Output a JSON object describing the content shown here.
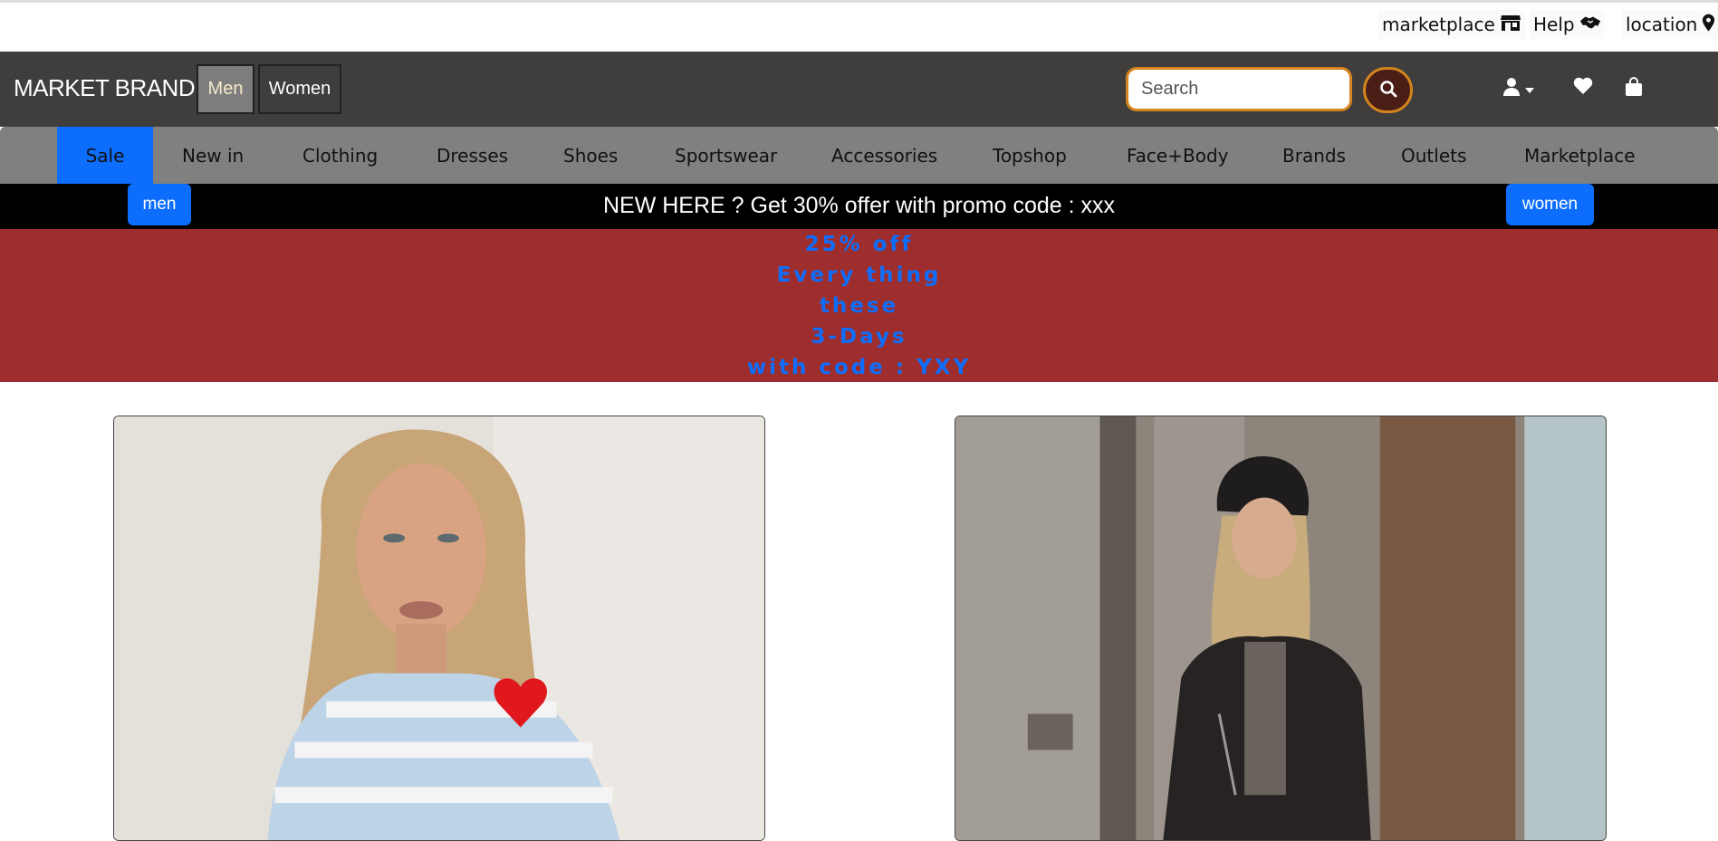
{
  "utility": {
    "marketplace_label": "marketplace",
    "help_label": "Help",
    "location_label": "location"
  },
  "header": {
    "brand": "MARKET BRAND",
    "gender_men": "Men",
    "gender_women": "Women",
    "search_placeholder": "Search",
    "icons": [
      "user-icon",
      "caret-down-icon",
      "heart-icon",
      "shopping-bag-icon"
    ]
  },
  "nav": {
    "items": [
      "Sale",
      "New in",
      "Clothing",
      "Dresses",
      "Shoes",
      "Sportswear",
      "Accessories",
      "Topshop",
      "Face+Body",
      "Brands",
      "Outlets",
      "Marketplace"
    ],
    "active": "Sale"
  },
  "promo": {
    "text": "NEW HERE ? Get 30% offer with promo code : xxx",
    "left_pill": "men",
    "right_pill": "women"
  },
  "sale_banner": {
    "lines": [
      "25% off",
      "Every thing",
      "these",
      "3-Days",
      "with code : YXY"
    ]
  },
  "colors": {
    "header_bg": "#403e3c",
    "nav_bg": "#808080",
    "accent_blue": "#0d6efd",
    "banner_red": "#9e2d2d",
    "search_border": "#d4841e"
  }
}
